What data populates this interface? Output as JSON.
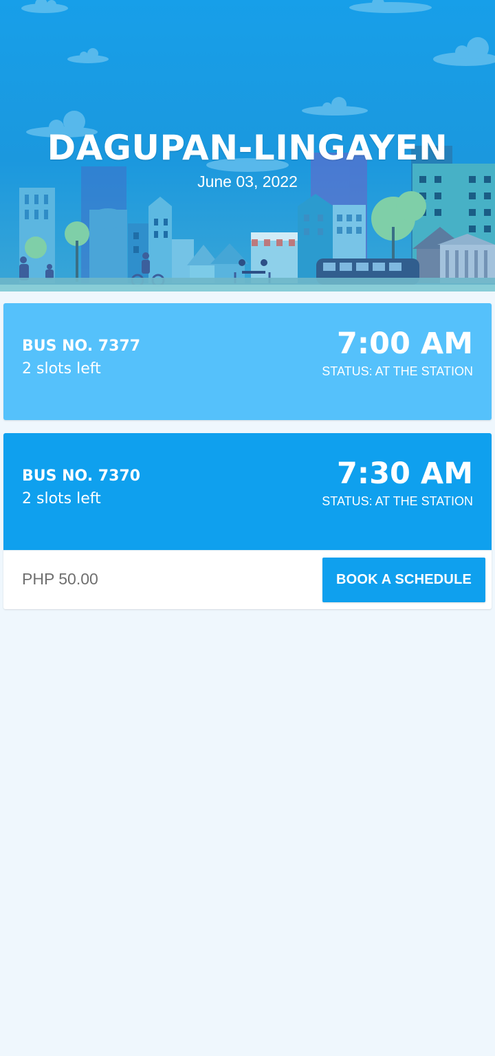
{
  "header": {
    "route": "DAGUPAN-LINGAYEN",
    "date": "June 03, 2022",
    "illustration": "city-skyline-illustration"
  },
  "schedules": [
    {
      "bus_no": "BUS NO. 7377",
      "slots": "2 slots left",
      "time": "7:00 AM",
      "status": "STATUS: AT THE STATION",
      "color": "#55c1fb"
    },
    {
      "bus_no": "BUS NO. 7370",
      "slots": "2 slots left",
      "time": "7:30 AM",
      "status": "STATUS: AT THE STATION",
      "color": "#0fa0ee",
      "expanded": true,
      "price": "PHP 50.00",
      "book_label": "BOOK A SCHEDULE"
    }
  ],
  "colors": {
    "accent": "#0fa0ee",
    "background": "#eff7fd"
  }
}
